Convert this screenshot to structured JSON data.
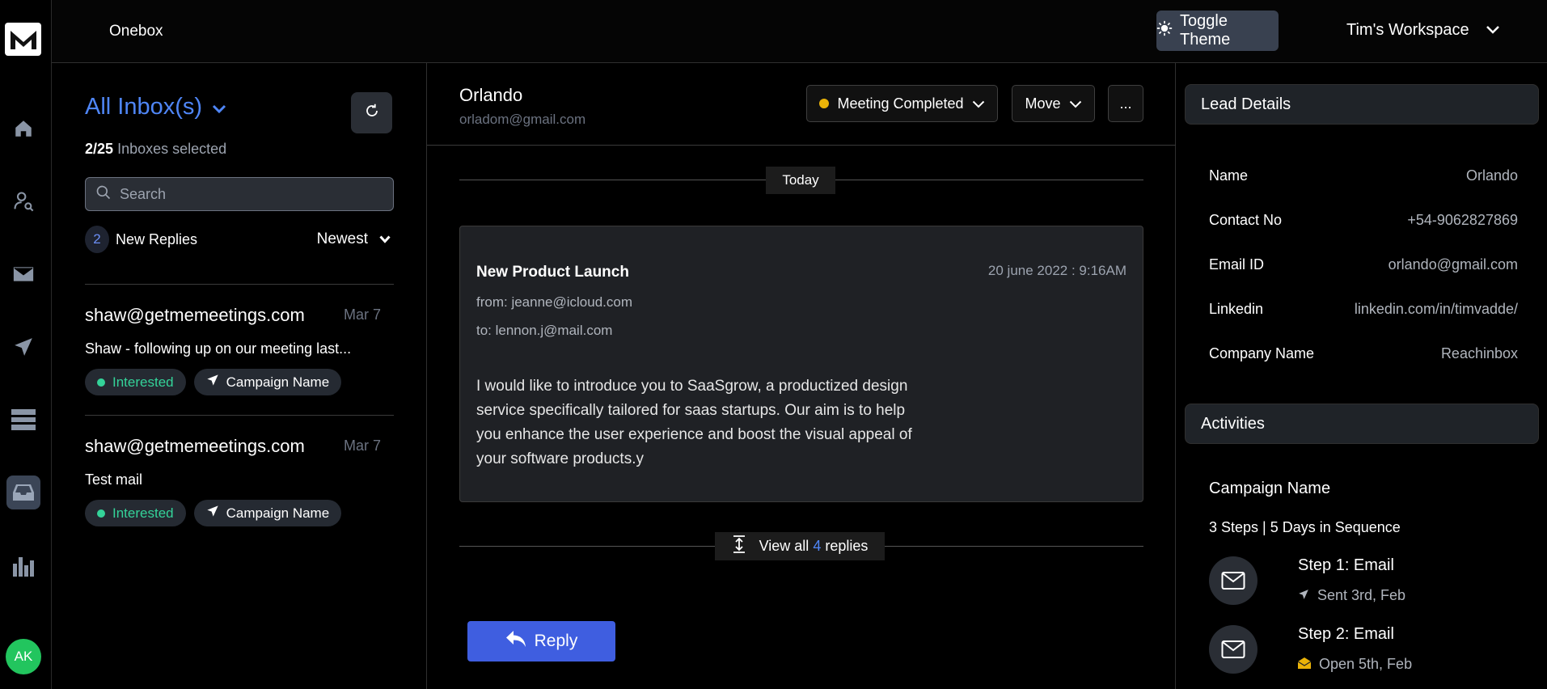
{
  "app": {
    "title": "Onebox"
  },
  "header": {
    "toggle_theme": "Toggle Theme",
    "workspace": "Tim's Workspace"
  },
  "rail": {
    "avatar_initials": "AK",
    "icons": [
      "logo-icon",
      "home-icon",
      "user-search-icon",
      "mail-icon",
      "send-icon",
      "list-icon",
      "inbox-icon",
      "bar-chart-icon"
    ]
  },
  "inbox_list": {
    "title": "All Inbox(s)",
    "selected_count": "2/25",
    "selected_label": "Inboxes selected",
    "search_placeholder": "Search",
    "new_replies_count": "2",
    "new_replies_label": "New Replies",
    "sort": "Newest",
    "items": [
      {
        "from": "shaw@getmemeetings.com",
        "date": "Mar 7",
        "subject": "Shaw - following up on our meeting last...",
        "status": "Interested",
        "campaign": "Campaign Name"
      },
      {
        "from": "shaw@getmemeetings.com",
        "date": "Mar 7",
        "subject": "Test mail",
        "status": "Interested",
        "campaign": "Campaign Name"
      }
    ]
  },
  "conversation": {
    "name": "Orlando",
    "email": "orladom@gmail.com",
    "status": "Meeting Completed",
    "move_label": "Move",
    "more_label": "...",
    "day_label": "Today",
    "message": {
      "subject": "New Product Launch",
      "date": "20 june 2022 : 9:16AM",
      "from": "from: jeanne@icloud.com",
      "to": "to: lennon.j@mail.com",
      "body": "I would like to introduce you to SaaSgrow, a productized design service specifically tailored for saas startups. Our aim is to help you enhance the user experience and boost the visual appeal of your software products.y"
    },
    "view_all_prefix": "View all",
    "view_all_count": "4",
    "view_all_suffix": "replies",
    "reply_label": "Reply"
  },
  "lead_details": {
    "title": "Lead Details",
    "fields": [
      {
        "label": "Name",
        "value": "Orlando"
      },
      {
        "label": "Contact No",
        "value": "+54-9062827869"
      },
      {
        "label": "Email ID",
        "value": "orlando@gmail.com"
      },
      {
        "label": "Linkedin",
        "value": "linkedin.com/in/timvadde/"
      },
      {
        "label": "Company Name",
        "value": "Reachinbox"
      }
    ]
  },
  "activities": {
    "title": "Activities",
    "campaign_name": "Campaign Name",
    "sequence": "3 Steps | 5 Days in Sequence",
    "steps": [
      {
        "title": "Step 1: Email",
        "status": "Sent 3rd, Feb",
        "status_icon": "send-icon"
      },
      {
        "title": "Step 2: Email",
        "status": "Open 5th, Feb",
        "status_icon": "open-mail-icon"
      }
    ]
  },
  "colors": {
    "accent": "#4f86f7",
    "reply_button": "#3f5ee0",
    "interested": "#34d399",
    "meeting_status": "#eab308",
    "avatar": "#22c55e"
  }
}
